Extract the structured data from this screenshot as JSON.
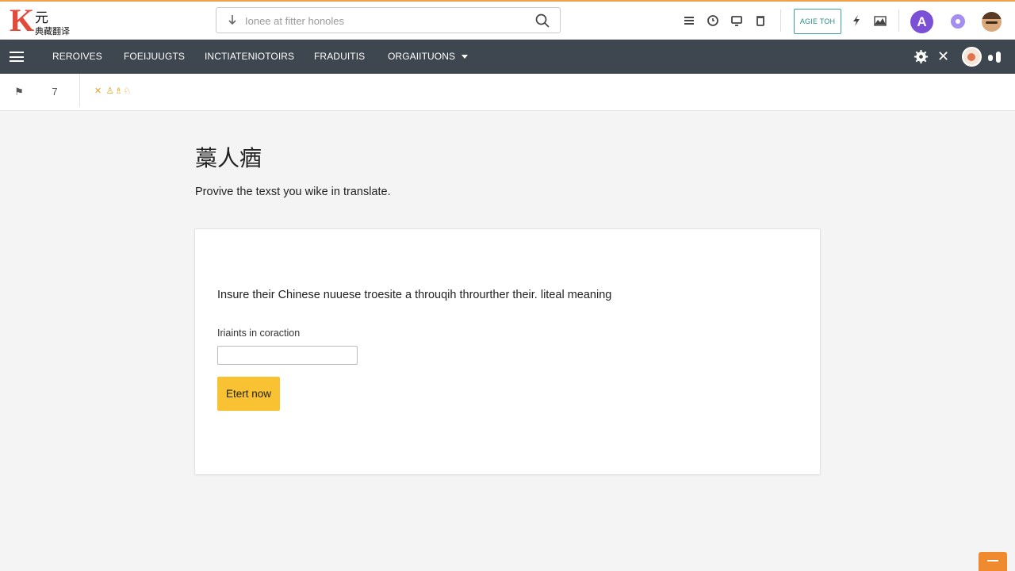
{
  "logo": {
    "letter": "K",
    "glyph_top": "元",
    "glyph_bottom": "典藏翻译"
  },
  "search": {
    "placeholder": "Ionee at fitter honoles"
  },
  "header": {
    "badge_label": "AGIE TOH",
    "avatar_letter": "A"
  },
  "nav": {
    "items": [
      {
        "label": "REROIVES"
      },
      {
        "label": "FOEIJUUGTS"
      },
      {
        "label": "INCTIATENIOTOIRS"
      },
      {
        "label": "FRADUITIS"
      },
      {
        "label": "ORGAIITUONS"
      }
    ]
  },
  "subbar": {
    "tag": "✕ ♙♗♘"
  },
  "main": {
    "title": "藁人㾞",
    "subtitle": "Provive the texst you wike in translate.",
    "card": {
      "description": "Insure their Chinese nuuese troesite a throuqih throurther their. liteal meaning",
      "field_label": "Iriaints in coraction",
      "field_value": "",
      "button_label": "Etert now"
    }
  },
  "colors": {
    "accent": "#f8c233",
    "nav_bg": "#3e4750",
    "brand_red": "#e24a3b",
    "fab": "#f08a2e"
  }
}
